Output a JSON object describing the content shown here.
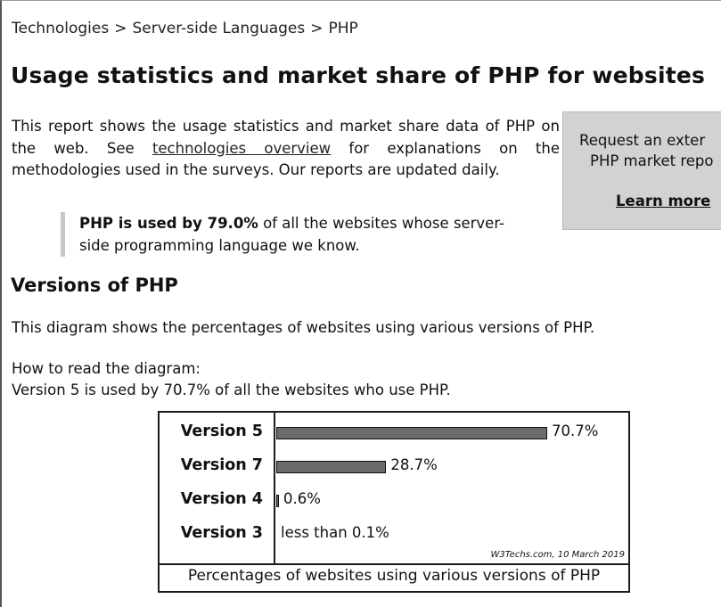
{
  "breadcrumb": {
    "items": [
      "Technologies",
      "Server-side Languages",
      "PHP"
    ],
    "separator": ">"
  },
  "page_title": "Usage statistics and market share of PHP for websites",
  "intro": {
    "before_link": "This report shows the usage statistics and market share data of PHP on the web. See ",
    "link_text": "technologies overview",
    "after_link": " for explanations on the methodologies used in the surveys. Our reports are updated daily."
  },
  "sidebox": {
    "line1": "Request an exter",
    "line2": "PHP market repo",
    "learn_more": "Learn more"
  },
  "callout": {
    "bold": "PHP is used by 79.0%",
    "rest": " of all the websites whose server-side programming language we know."
  },
  "versions_section": {
    "title": "Versions of PHP",
    "description": "This diagram shows the percentages of websites using various versions of PHP.",
    "howto_line1": "How to read the diagram:",
    "howto_line2": "Version 5 is used by 70.7% of all the websites who use PHP."
  },
  "chart_data": {
    "type": "bar",
    "orientation": "horizontal",
    "categories": [
      "Version 5",
      "Version 7",
      "Version 4",
      "Version 3"
    ],
    "values": [
      70.7,
      28.7,
      0.6,
      0.05
    ],
    "value_labels": [
      "70.7%",
      "28.7%",
      "0.6%",
      "less than 0.1%"
    ],
    "credit": "W3Techs.com, 10 March 2019",
    "caption": "Percentages of websites using various versions of PHP",
    "xlim": [
      0,
      100
    ],
    "grid": false
  },
  "colors": {
    "bar": "#6a6a6a",
    "sidebox": "#d2d2d2"
  }
}
